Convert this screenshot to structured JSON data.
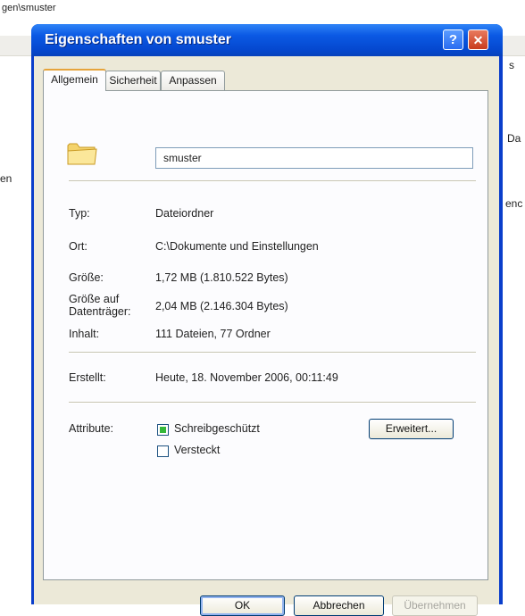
{
  "background_window": {
    "path_text": "gen\\smuster",
    "right_text_1": "s",
    "right_text_2": "Da",
    "right_text_3": "enc",
    "left_text_1": "en"
  },
  "dialog": {
    "title": "Eigenschaften von smuster",
    "help_label": "?",
    "close_label": "✕",
    "tabs": [
      {
        "label": "Allgemein",
        "active": true
      },
      {
        "label": "Sicherheit",
        "active": false
      },
      {
        "label": "Anpassen",
        "active": false
      }
    ],
    "name_value": "smuster",
    "icon": "folder-icon",
    "properties": {
      "typ_label": "Typ:",
      "typ_value": "Dateiordner",
      "ort_label": "Ort:",
      "ort_value": "C:\\Dokumente und Einstellungen",
      "groesse_label": "Größe:",
      "groesse_value": "1,72 MB (1.810.522 Bytes)",
      "groesse_auf_label_1": "Größe auf",
      "groesse_auf_label_2": "Datenträger:",
      "groesse_auf_value": "2,04 MB (2.146.304 Bytes)",
      "inhalt_label": "Inhalt:",
      "inhalt_value": "111 Dateien, 77 Ordner",
      "erstellt_label": "Erstellt:",
      "erstellt_value": "Heute, 18. November 2006, 00:11:49"
    },
    "attributes": {
      "label": "Attribute:",
      "readonly_label": "Schreibgeschützt",
      "readonly_checked": true,
      "hidden_label": "Versteckt",
      "hidden_checked": false,
      "advanced_button": "Erweitert..."
    },
    "buttons": {
      "ok": "OK",
      "cancel": "Abbrechen",
      "apply": "Übernehmen"
    }
  }
}
